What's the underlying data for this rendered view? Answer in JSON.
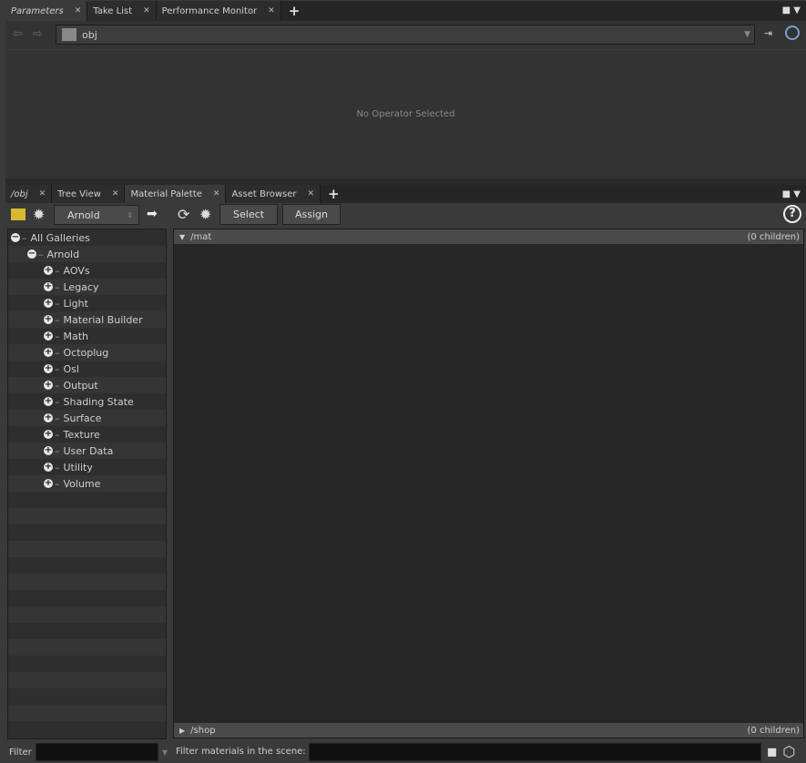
{
  "top_tabs": [
    {
      "label": "Parameters"
    },
    {
      "label": "Take List"
    },
    {
      "label": "Performance Monitor"
    }
  ],
  "address": {
    "path": "obj"
  },
  "params": {
    "empty_text": "No Operator Selected"
  },
  "bottom_tabs": [
    {
      "label": "/obj"
    },
    {
      "label": "Tree View"
    },
    {
      "label": "Material Palette"
    },
    {
      "label": "Asset Browser"
    }
  ],
  "toolbar": {
    "renderer": "Arnold",
    "select_label": "Select",
    "assign_label": "Assign",
    "help": "?"
  },
  "tree": {
    "root": "All Galleries",
    "group": "Arnold",
    "items": [
      "AOVs",
      "Legacy",
      "Light",
      "Material Builder",
      "Math",
      "Octoplug",
      "Osl",
      "Output",
      "Shading State",
      "Surface",
      "Texture",
      "User Data",
      "Utility",
      "Volume"
    ]
  },
  "mat": {
    "path": "/mat",
    "children": "(0 children)"
  },
  "shop": {
    "path": "/shop",
    "children": "(0 children)"
  },
  "filter": {
    "label": "Filter",
    "value": "",
    "scene_label": "Filter materials in the scene:",
    "scene_value": ""
  }
}
